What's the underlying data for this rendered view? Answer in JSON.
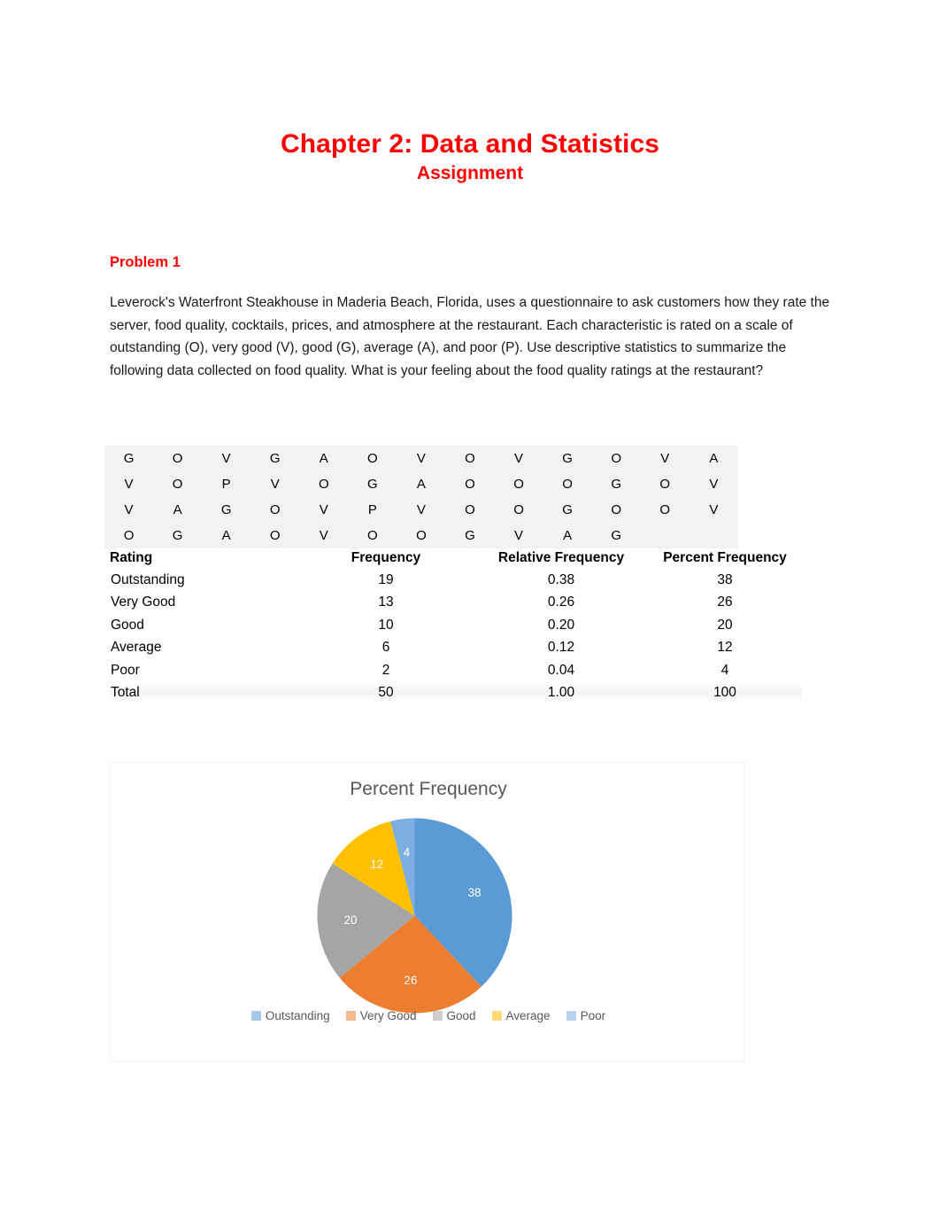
{
  "document": {
    "title": "Chapter 2: Data and Statistics",
    "subtitle": "Assignment",
    "title_color": "#FF0000"
  },
  "problem": {
    "heading": "Problem 1",
    "body": "Leverock's Waterfront Steakhouse in Maderia Beach, Florida, uses a questionnaire to ask customers how they rate the server, food quality, cocktails, prices, and atmosphere at the restaurant. Each characteristic is rated on a scale of outstanding (O), very good (V), good (G), average (A), and poor (P). Use descriptive statistics to summarize the following data collected on food quality. What is your feeling about the food quality ratings at the restaurant?"
  },
  "raw_data": {
    "rows": [
      [
        "G",
        "O",
        "V",
        "G",
        "A",
        "O",
        "V",
        "O",
        "V",
        "G",
        "O",
        "V",
        "A"
      ],
      [
        "V",
        "O",
        "P",
        "V",
        "O",
        "G",
        "A",
        "O",
        "O",
        "O",
        "G",
        "O",
        "V"
      ],
      [
        "V",
        "A",
        "G",
        "O",
        "V",
        "P",
        "V",
        "O",
        "O",
        "G",
        "O",
        "O",
        "V"
      ],
      [
        "O",
        "G",
        "A",
        "O",
        "V",
        "O",
        "O",
        "G",
        "V",
        "A",
        "G",
        "",
        ""
      ]
    ]
  },
  "frequency_table": {
    "headers": {
      "rating": "Rating",
      "frequency": "Frequency",
      "relative_frequency": "Relative Frequency",
      "percent_frequency": "Percent Frequency"
    },
    "rows": [
      {
        "rating": "Outstanding",
        "frequency": "19",
        "relative": "0.38",
        "percent": "38"
      },
      {
        "rating": "Very Good",
        "frequency": "13",
        "relative": "0.26",
        "percent": "26"
      },
      {
        "rating": "Good",
        "frequency": "10",
        "relative": "0.20",
        "percent": "20"
      },
      {
        "rating": "Average",
        "frequency": "6",
        "relative": "0.12",
        "percent": "12"
      },
      {
        "rating": "Poor",
        "frequency": "2",
        "relative": "0.04",
        "percent": "4"
      },
      {
        "rating": "Total",
        "frequency": "50",
        "relative": "1.00",
        "percent": "100"
      }
    ]
  },
  "chart_data": {
    "type": "pie",
    "title": "Percent Frequency",
    "categories": [
      "Outstanding",
      "Very Good",
      "Good",
      "Average",
      "Poor"
    ],
    "values": [
      38,
      26,
      20,
      12,
      4
    ],
    "labels": [
      "38",
      "26",
      "20",
      "12",
      "4"
    ],
    "colors": [
      "#5B9BD5",
      "#ED7D31",
      "#A5A5A5",
      "#FFC000",
      "#7CAEE0"
    ],
    "legend_position": "bottom",
    "grid": false,
    "xlabel": "",
    "ylabel": ""
  }
}
